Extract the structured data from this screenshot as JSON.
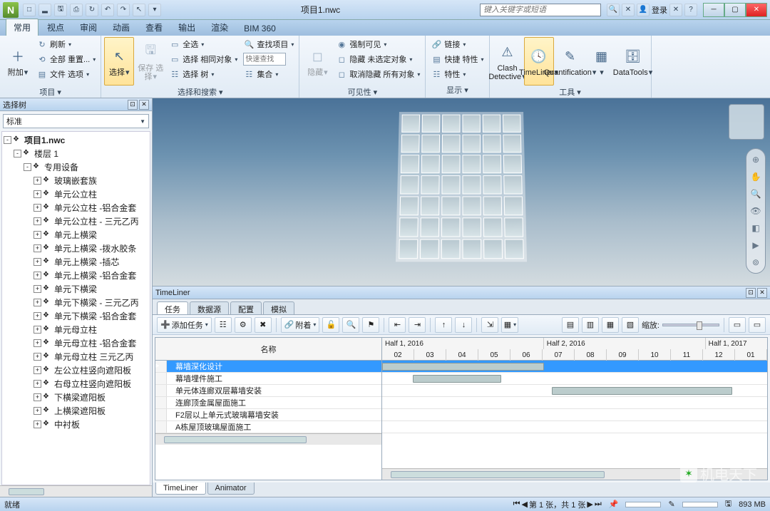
{
  "titlebar": {
    "app_letter": "N",
    "doc_title": "项目1.nwc",
    "search_placeholder": "键入关键字或短语",
    "login": "登录"
  },
  "tabs": [
    "常用",
    "视点",
    "审阅",
    "动画",
    "查看",
    "输出",
    "渲染",
    "BIM 360"
  ],
  "active_tab": 0,
  "ribbon": {
    "groups": [
      {
        "label": "项目",
        "big": [
          {
            "name": "append",
            "label": "附加",
            "icon": "＋"
          }
        ],
        "small": [
          {
            "name": "refresh",
            "label": "刷新",
            "icon": "↻"
          },
          {
            "name": "reset-all",
            "label": "全部 重置...",
            "icon": "⟲"
          },
          {
            "name": "file-options",
            "label": "文件 选项",
            "icon": "▤"
          }
        ]
      },
      {
        "label": "选择和搜索",
        "big": [
          {
            "name": "select",
            "label": "选择",
            "icon": "↖",
            "sel": true
          },
          {
            "name": "save",
            "label": "保存 选择",
            "icon": "🖫",
            "dis": true
          }
        ],
        "small": [
          {
            "name": "select-all",
            "label": "全选",
            "icon": "▭"
          },
          {
            "name": "select-same",
            "label": "选择 相同对象",
            "icon": "▭"
          },
          {
            "name": "select-tree",
            "label": "选择 树",
            "icon": "☷"
          }
        ],
        "small2": [
          {
            "name": "find-items",
            "label": "查找项目",
            "icon": "🔍"
          },
          {
            "name": "quick-find",
            "label": "快速查找",
            "input": true
          },
          {
            "name": "sets",
            "label": "集合",
            "icon": "☷"
          }
        ]
      },
      {
        "label": "可见性",
        "big": [
          {
            "name": "hide",
            "label": "隐藏",
            "icon": "◻",
            "dis": true
          }
        ],
        "small": [
          {
            "name": "force-visible",
            "label": "强制可见",
            "icon": "◉"
          },
          {
            "name": "hide-unselected",
            "label": "隐藏 未选定对象",
            "icon": "◻"
          },
          {
            "name": "unhide-all",
            "label": "取消隐藏 所有对象",
            "icon": "◻"
          }
        ]
      },
      {
        "label": "显示",
        "big": [],
        "small": [
          {
            "name": "links",
            "label": "链接",
            "icon": "🔗"
          },
          {
            "name": "quick-props",
            "label": "快捷 特性",
            "icon": "▤"
          },
          {
            "name": "properties",
            "label": "特性",
            "icon": "☷"
          }
        ]
      },
      {
        "label": "工具",
        "big": [
          {
            "name": "clash",
            "label": "Clash Detective",
            "icon": "⚠"
          },
          {
            "name": "timeliner",
            "label": "TimeLiner",
            "icon": "🕓",
            "sel": true
          },
          {
            "name": "quantification",
            "label": "Quantification",
            "icon": "✎"
          },
          {
            "name": "more",
            "label": "",
            "icon": "▦"
          },
          {
            "name": "datatools",
            "label": "DataTools",
            "icon": "🗄"
          }
        ]
      }
    ]
  },
  "sidebar": {
    "title": "选择树",
    "combo": "标准",
    "items": [
      {
        "d": 1,
        "exp": "-",
        "label": "项目1.nwc",
        "bold": true
      },
      {
        "d": 2,
        "exp": "-",
        "label": "楼层 1"
      },
      {
        "d": 3,
        "exp": "-",
        "label": "专用设备"
      },
      {
        "d": 4,
        "exp": "+",
        "label": "玻璃嵌套族"
      },
      {
        "d": 4,
        "exp": "+",
        "label": "单元公立柱"
      },
      {
        "d": 4,
        "exp": "+",
        "label": "单元公立柱 -铝合金套"
      },
      {
        "d": 4,
        "exp": "+",
        "label": "单元公立柱 - 三元乙丙"
      },
      {
        "d": 4,
        "exp": "+",
        "label": "单元上横梁"
      },
      {
        "d": 4,
        "exp": "+",
        "label": "单元上横梁 -拨水胶条"
      },
      {
        "d": 4,
        "exp": "+",
        "label": "单元上横梁 -插芯"
      },
      {
        "d": 4,
        "exp": "+",
        "label": "单元上横梁 -铝合金套"
      },
      {
        "d": 4,
        "exp": "+",
        "label": "单元下横梁"
      },
      {
        "d": 4,
        "exp": "+",
        "label": "单元下横梁 - 三元乙丙"
      },
      {
        "d": 4,
        "exp": "+",
        "label": "单元下横梁 -铝合金套"
      },
      {
        "d": 4,
        "exp": "+",
        "label": "单元母立柱"
      },
      {
        "d": 4,
        "exp": "+",
        "label": "单元母立柱 -铝合金套"
      },
      {
        "d": 4,
        "exp": "+",
        "label": "单元母立柱 三元乙丙"
      },
      {
        "d": 4,
        "exp": "+",
        "label": "左公立柱竖向遮阳板"
      },
      {
        "d": 4,
        "exp": "+",
        "label": "右母立柱竖向遮阳板"
      },
      {
        "d": 4,
        "exp": "+",
        "label": "下横梁遮阳板"
      },
      {
        "d": 4,
        "exp": "+",
        "label": "上横梁遮阳板"
      },
      {
        "d": 4,
        "exp": "+",
        "label": "中衬板"
      }
    ]
  },
  "timeliner": {
    "title": "TimeLiner",
    "tabs": [
      "任务",
      "数据源",
      "配置",
      "模拟"
    ],
    "active_tab": 0,
    "add_task": "添加任务",
    "attach": "附着",
    "zoom": "缩放:",
    "col_name": "名称",
    "halves": [
      "Half 1, 2016",
      "Half 2, 2016",
      "Half 1, 2017"
    ],
    "months": [
      "02",
      "03",
      "04",
      "05",
      "06",
      "07",
      "08",
      "09",
      "10",
      "11",
      "12",
      "01"
    ],
    "rows": [
      {
        "name": "幕墙深化设计",
        "active": true,
        "bar": [
          0,
          42
        ]
      },
      {
        "name": "幕墙埋件施工",
        "bar": [
          8,
          23
        ]
      },
      {
        "name": "单元体连廊双层幕墙安装",
        "bar": [
          44,
          47
        ]
      },
      {
        "name": "连廊顶金属屋面施工"
      },
      {
        "name": "F2层以上单元式玻璃幕墙安装"
      },
      {
        "name": "A栋屋顶玻璃屋面施工"
      }
    ],
    "bottom_tabs": [
      "TimeLiner",
      "Animator"
    ]
  },
  "status": {
    "ready": "就绪",
    "pager": "第 1 张，共 1 张",
    "mem": "893 MB"
  },
  "watermark": "机电天下"
}
